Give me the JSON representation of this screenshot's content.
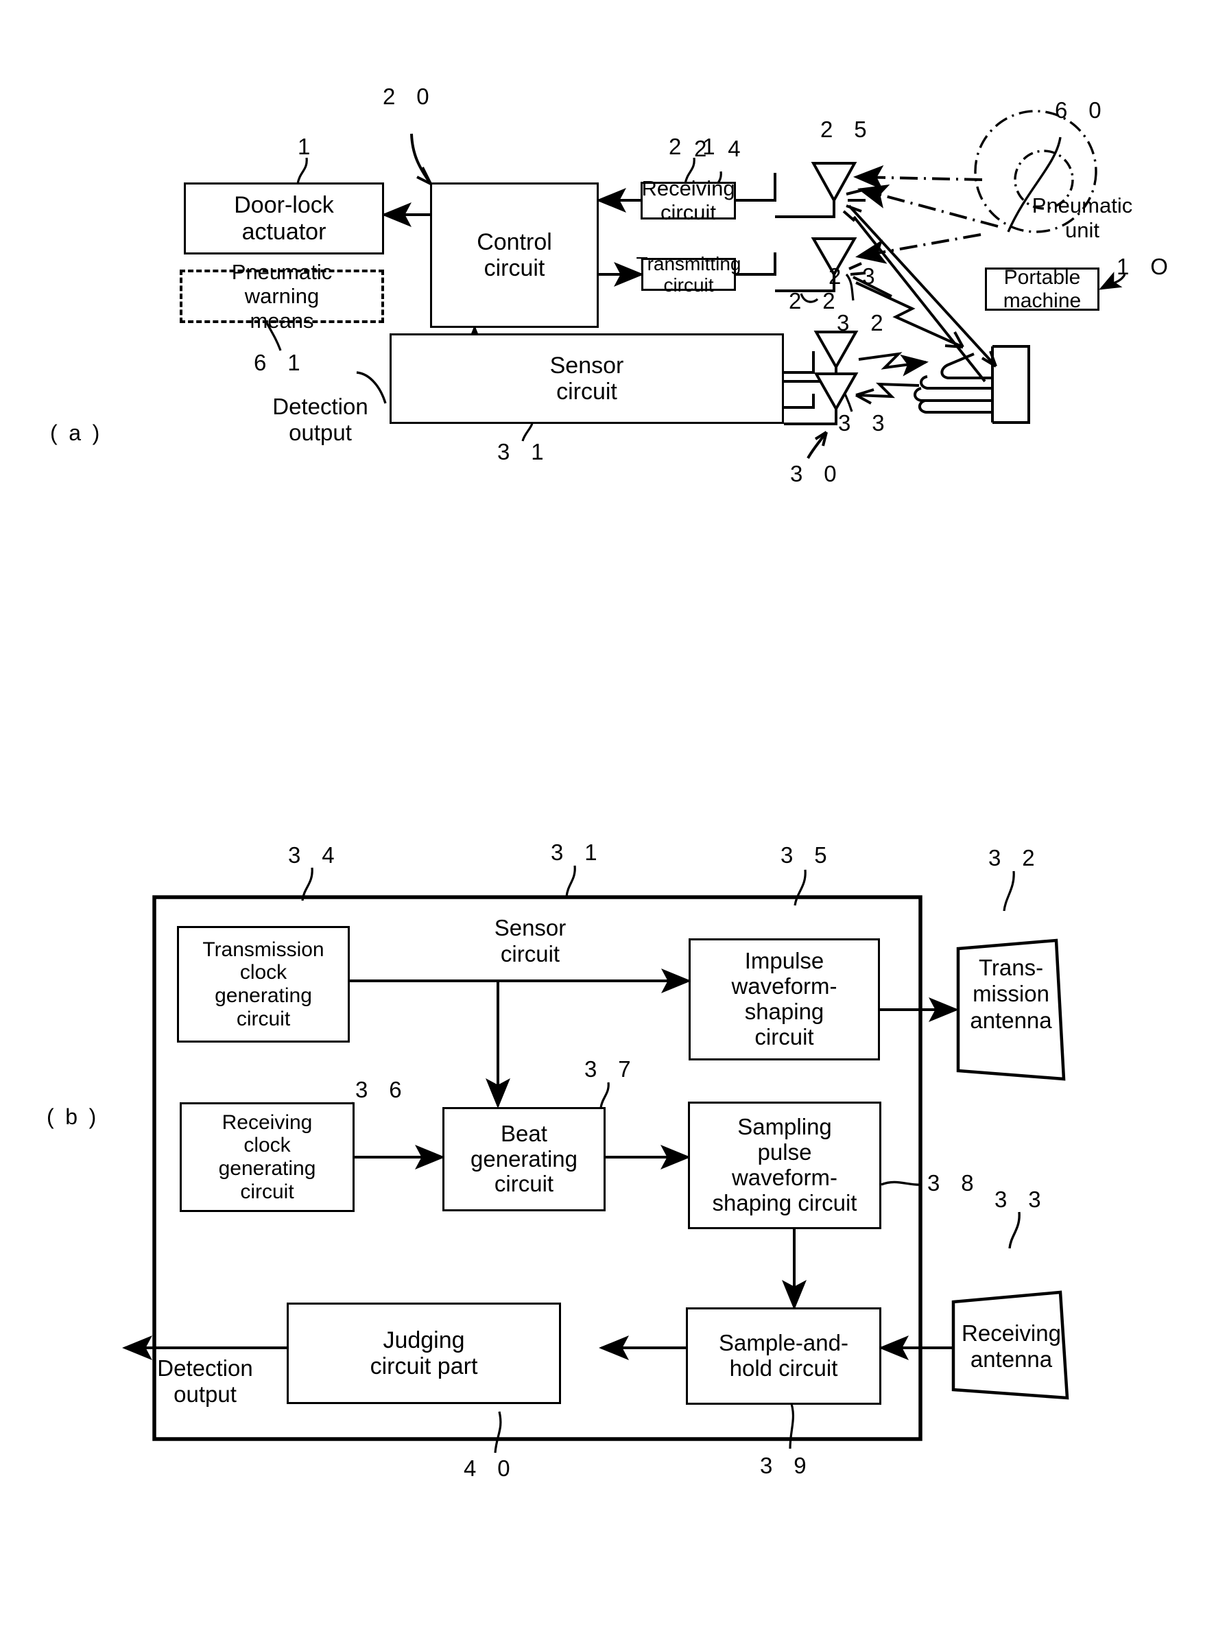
{
  "figure_labels": {
    "a": "( a )",
    "b": "( b )"
  },
  "fig_a": {
    "boxes": {
      "door_lock_actuator": "Door-lock\nactuator",
      "control_circuit": "Control\ncircuit",
      "pneumatic_warning_means": "Pneumatic\nwarning\nmeans",
      "receiving_circuit": "Receiving\ncircuit",
      "transmitting_circuit": "Transmitting\ncircuit",
      "sensor_circuit": "Sensor\ncircuit",
      "portable_machine": "Portable\nmachine"
    },
    "annotations": {
      "pneumatic_unit": "Pneumatic\nunit",
      "detection_output": "Detection\noutput"
    },
    "ref_numbers": {
      "system_20": "2 0",
      "door_lock_1": "1",
      "control_21": "2 1",
      "receiving_24": "2 4",
      "antenna_25": "2 5",
      "pneumatic_unit_60": "6 0",
      "transmitting_22": "2 2",
      "tx_antenna_23": "2 3",
      "portable_machine_10": "1 O",
      "warning_61": "6 1",
      "sensor_31": "3 1",
      "sensor_tx_antenna_32": "3 2",
      "sensor_rx_antenna_33": "3 3",
      "sensor_unit_30": "3 0"
    }
  },
  "fig_b": {
    "title": "Sensor\ncircuit",
    "boxes": {
      "transmission_clock": "Transmission\nclock\ngenerating\ncircuit",
      "impulse_waveform": "Impulse\nwaveform-\nshaping\ncircuit",
      "transmission_antenna": "Trans-\nmission\nantenna",
      "receiving_clock": "Receiving\nclock\ngenerating\ncircuit",
      "beat_generating": "Beat\ngenerating\ncircuit",
      "sampling_pulse": "Sampling\npulse\nwaveform-\nshaping circuit",
      "judging_circuit": "Judging\ncircuit part",
      "sample_and_hold": "Sample-and-\nhold circuit",
      "receiving_antenna": "Receiving\nantenna"
    },
    "annotations": {
      "detection_output": "Detection\noutput"
    },
    "ref_numbers": {
      "transmission_clock_34": "3 4",
      "sensor_circuit_31": "3 1",
      "impulse_35": "3 5",
      "tx_antenna_32": "3 2",
      "receiving_clock_36": "3 6",
      "beat_37": "3 7",
      "sampling_38": "3 8",
      "rx_antenna_33": "3 3",
      "judging_40": "4 0",
      "sample_hold_39": "3 9"
    }
  },
  "colors": {
    "ink": "#000000",
    "paper": "#ffffff"
  }
}
